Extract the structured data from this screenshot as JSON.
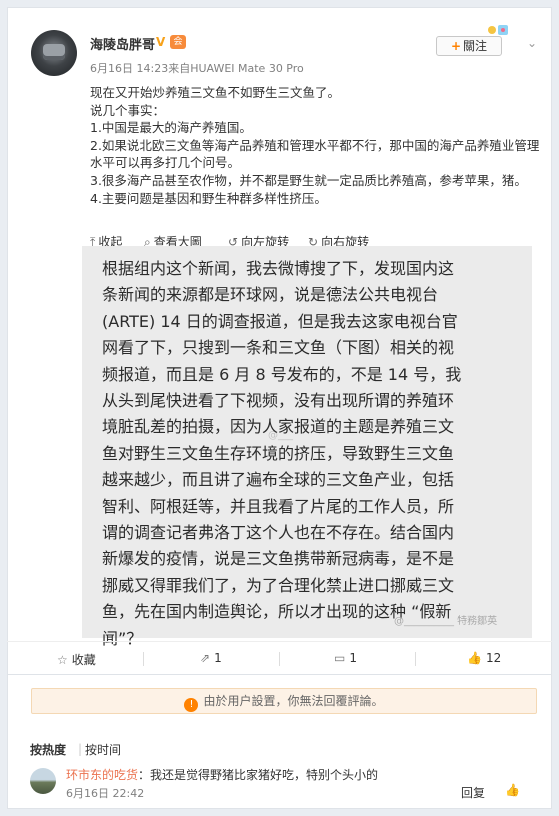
{
  "post": {
    "author": "海陵岛胖哥",
    "verified_mark": "V",
    "meta": "6月16日 14:23来自HUAWEI Mate 30 Pro",
    "follow_label": "關注",
    "lines": [
      "现在又开始炒养殖三文鱼不如野生三文鱼了。",
      "说几个事实：",
      "1.中国是最大的海产养殖国。",
      "2.如果说北欧三文鱼等海产品养殖和管理水平都不行，那中国的海产品养殖业管理水平可以再多打几个问号。",
      "3.很多海产品甚至农作物，并不都是野生就一定品质比养殖高，参考苹果，猪。",
      "4.主要问题是基因和野生种群多样性挤压。"
    ],
    "toolbar": {
      "collapse": "收起",
      "view_large": "查看大圖",
      "rotate_left": "向左旋转",
      "rotate_right": "向右旋转"
    },
    "image_text_lines": [
      "根据组内这个新闻，我去微博搜了下，发现国内这",
      "条新闻的来源都是环球网，说是德法公共电视台",
      "(ARTE) 14 日的调查报道，但是我去这家电视台官",
      "网看了下，只搜到一条和三文鱼（下图）相关的视",
      "频报道，而且是 6 月 8 号发布的，不是 14 号，我",
      "从头到尾快进看了下视频，没有出现所谓的养殖环",
      "境脏乱差的拍摄，因为人家报道的主题是养殖三文",
      "鱼对野生三文鱼生存环境的挤压，导致野生三文鱼",
      "越来越少，而且讲了遍布全球的三文鱼产业，包括",
      "智利、阿根廷等，并且我看了片尾的工作人员，所",
      "谓的调查记者弗洛丁这个人也在不存在。结合国内",
      "新爆发的疫情，说是三文鱼携带新冠病毒，是不是",
      "挪威又得罪我们了，为了合理化禁止进口挪威三文",
      "鱼，先在国内制造舆论，所以才出现的这种 “假新",
      "闻”？"
    ],
    "watermark_mid": "@___",
    "watermark_corner": "@__________ 特務鄒英"
  },
  "actions": {
    "favorite": "收藏",
    "repost_count": "1",
    "comment_count": "1",
    "like_count": "12"
  },
  "comments_section": {
    "notice": "由於用户設置，你無法回覆評論。",
    "sort_hot": "按热度",
    "sort_time": "按时间",
    "items": [
      {
        "user": "环市东的吃货",
        "text": "：我还是觉得野猪比家猪好吃，特别个头小的",
        "time": "6月16日 22:42",
        "reply": "回复"
      }
    ]
  },
  "colors": {
    "accent": "#ff8200",
    "commenter_name": "#eb7350",
    "notice_bg": "#fdf2e6"
  }
}
